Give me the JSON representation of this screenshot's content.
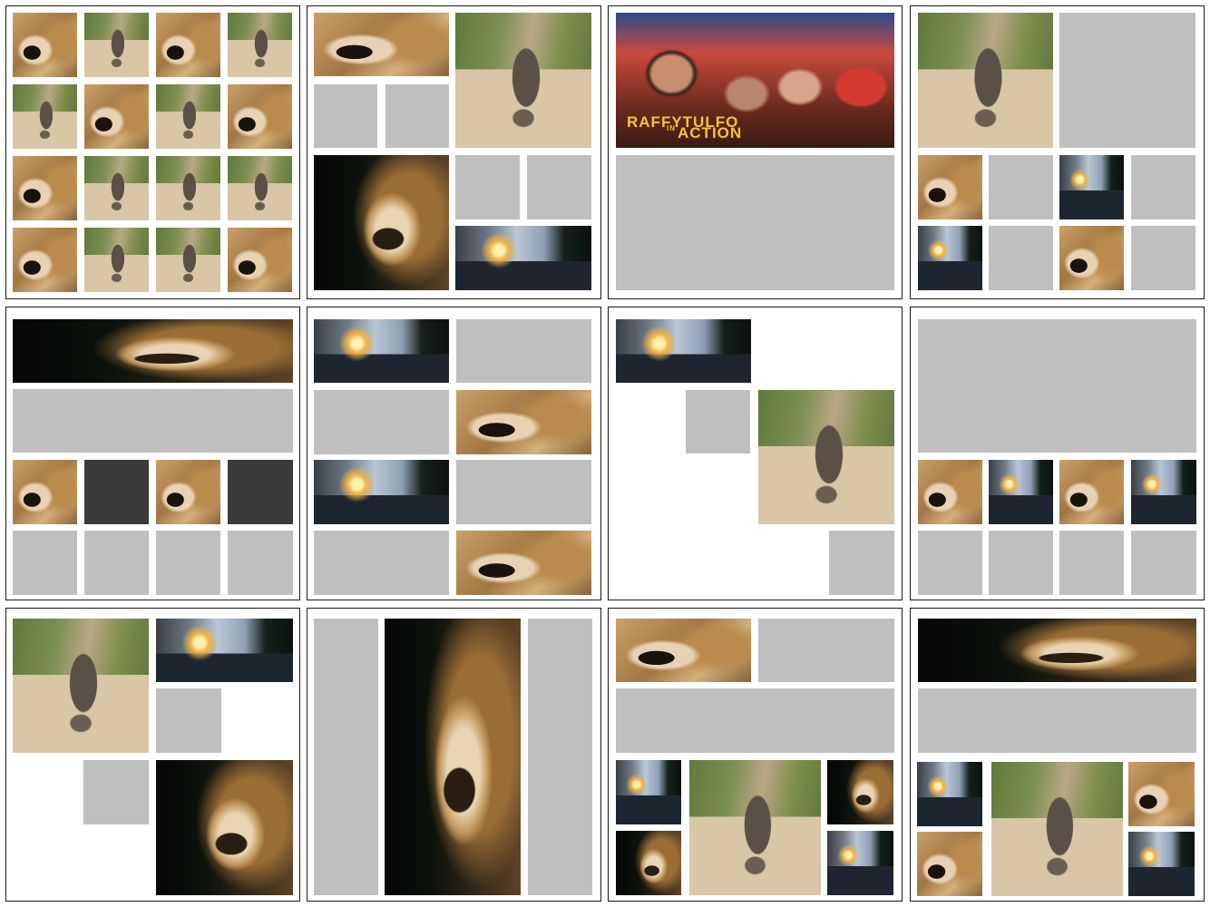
{
  "tv_banner": {
    "line1": "RAFFYTULFO",
    "line2_prefix": "IN",
    "line2": "ACTION"
  },
  "colors": {
    "placeholder": "#bfbfbf",
    "dark_placeholder": "#3a3a3a",
    "panel_border": "#1a1a1a"
  },
  "icons": {
    "lion": "lion-photo",
    "elephant": "elephant-photo",
    "street": "night-street-photo",
    "tv": "tv-show-photo"
  }
}
